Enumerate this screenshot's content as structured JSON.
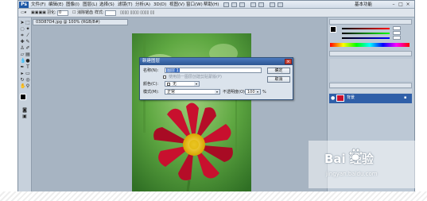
{
  "menubar": {
    "logo": "Ps",
    "items": [
      "文件(F)",
      "编辑(E)",
      "图像(I)",
      "图层(L)",
      "选择(S)",
      "滤镜(T)",
      "分析(A)",
      "3D(D)",
      "视图(V)",
      "窗口(W)",
      "帮助(H)"
    ],
    "workspace": "基本功能",
    "window_controls": [
      "–",
      "□",
      "×"
    ]
  },
  "options_bar": {
    "feather_label": "羽化:",
    "feather_value": "0",
    "antialias_label": "消除锯齿",
    "style_label": "样式:"
  },
  "document": {
    "tab_title": "03D87D4.jpg @ 100% (RGB/8#)"
  },
  "dialog": {
    "title": "新建图层",
    "close_glyph": "×",
    "name_label": "名称(N):",
    "name_value": "图层 1",
    "clip_label": "使用前一图层创建剪贴蒙版(P)",
    "color_label": "颜色(C):",
    "color_value": "无",
    "mode_label": "模式(M):",
    "mode_value": "正常",
    "opacity_label": "不透明度(O):",
    "opacity_value": "100",
    "opacity_unit": "%",
    "ok_label": "确定",
    "cancel_label": "取消"
  },
  "layers_panel": {
    "layer_name": "背景"
  },
  "watermark": {
    "logo_text": "Bai 经验",
    "url": "jingyan.baidu.com"
  },
  "colors": {
    "app_bg": "#b9c7d5",
    "dialog_title": "#2c5591",
    "layer_selected": "#2f5fa8",
    "flower_petal": "#c8102e",
    "flower_center": "#f2c400",
    "leaf_green": "#3f8a2e"
  }
}
